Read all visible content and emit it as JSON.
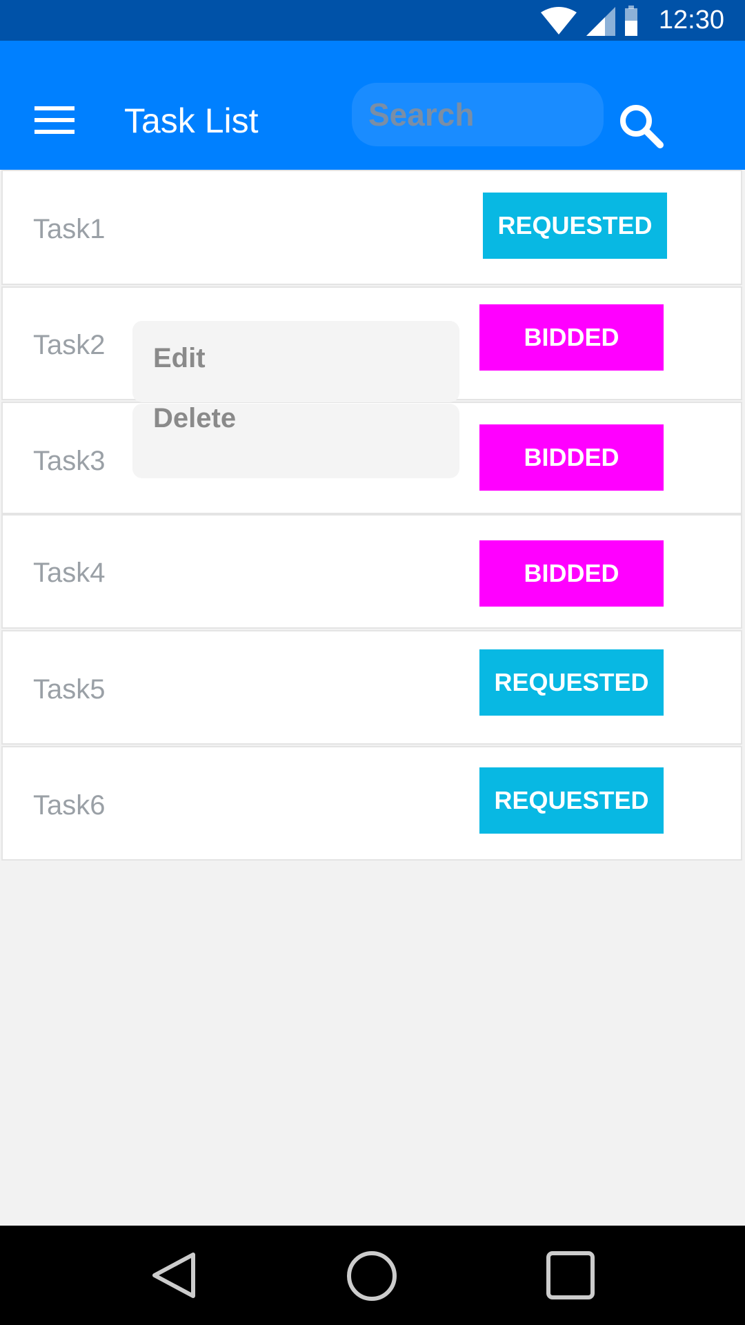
{
  "status_bar": {
    "time": "12:30",
    "icons": [
      "wifi-icon",
      "cell-signal-icon",
      "battery-icon"
    ]
  },
  "app_bar": {
    "menu_icon": "hamburger-menu-icon",
    "title": "Task List",
    "search_placeholder": "Search",
    "search_icon": "search-icon"
  },
  "tasks": [
    {
      "name": "Task1",
      "status": "REQUESTED"
    },
    {
      "name": "Task2",
      "status": "BIDDED"
    },
    {
      "name": "Task3",
      "status": "BIDDED"
    },
    {
      "name": "Task4",
      "status": "BIDDED"
    },
    {
      "name": "Task5",
      "status": "REQUESTED"
    },
    {
      "name": "Task6",
      "status": "REQUESTED"
    }
  ],
  "context_menu": {
    "items": [
      "Edit",
      "Delete"
    ]
  },
  "nav_bar": {
    "icons": [
      "back-icon",
      "home-icon",
      "recents-icon"
    ]
  },
  "colors": {
    "status_bar": "#0052a8",
    "app_bar": "#0080ff",
    "requested": "#08b8e3",
    "bidded": "#ff00ff"
  }
}
